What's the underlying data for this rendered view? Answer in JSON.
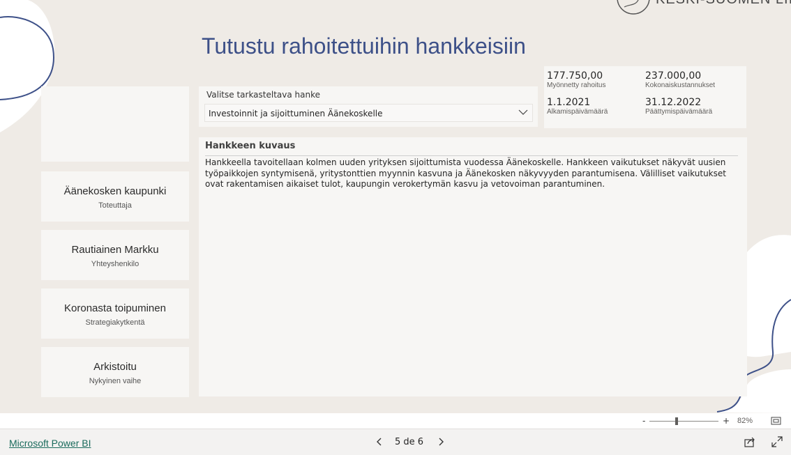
{
  "page": {
    "title": "Tutustu rahoitettuihin hankkeisiin",
    "logo_text": "KESKI-SUOMEN LIITTO"
  },
  "left_cards": [
    {
      "value": "",
      "label": ""
    },
    {
      "value": "Äänekosken kaupunki",
      "label": "Toteuttaja"
    },
    {
      "value": "Rautiainen Markku",
      "label": "Yhteyshenkilo"
    },
    {
      "value": "Koronasta toipuminen",
      "label": "Strategiakytkentä"
    },
    {
      "value": "Arkistoitu",
      "label": "Nykyinen vaihe"
    }
  ],
  "selector": {
    "label": "Valitse tarkasteltava hanke",
    "selected": "Investoinnit ja sijoittuminen Äänekoskelle"
  },
  "kpis": [
    {
      "value": "177.750,00",
      "label": "Myönnetty rahoitus"
    },
    {
      "value": "237.000,00",
      "label": "Kokonaiskustannukset"
    },
    {
      "value": "1.1.2021",
      "label": "Alkamispäivämäärä"
    },
    {
      "value": "31.12.2022",
      "label": "Päättymispäivämäärä"
    }
  ],
  "description": {
    "title": "Hankkeen kuvaus",
    "text": "Hankkeella tavoitellaan kolmen uuden yrityksen sijoittumista vuodessa Äänekoskelle. Hankkeen vaikutukset näkyvät uusien työpaikkojen syntymisenä, yritystonttien myynnin kasvuna ja Äänekosken näkyvyyden parantumisena. Välilliset vaikutukset ovat rakentamisen aikaiset tulot, kaupungin verokertymän kasvu ja vetovoiman parantuminen."
  },
  "zoom": {
    "minus": "-",
    "plus": "+",
    "level": "82%"
  },
  "footer": {
    "link": "Microsoft Power BI",
    "page_indicator": "5 de 6"
  },
  "colors": {
    "title": "#3d5088",
    "canvas": "#efebe6",
    "card": "#f7f6f4",
    "deco_line": "#3d5088",
    "link": "#1a6b5c"
  },
  "icons": {
    "dropdown": "chevron-down-icon",
    "prev": "chevron-left-icon",
    "next": "chevron-right-icon",
    "share": "share-icon",
    "fullscreen": "expand-icon",
    "fit": "fit-to-page-icon"
  }
}
